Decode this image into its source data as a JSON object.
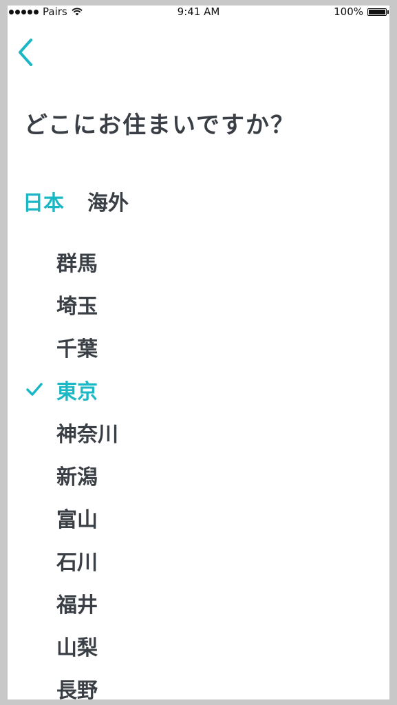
{
  "status_bar": {
    "carrier": "Pairs",
    "time": "9:41 AM",
    "battery": "100%",
    "icons": [
      "signal-icon",
      "wifi-icon",
      "battery-icon"
    ]
  },
  "header": {
    "back_icon": "chevron-left-icon",
    "title": "どこにお住まいですか？"
  },
  "tabs": [
    {
      "label": "日本",
      "active": true
    },
    {
      "label": "海外",
      "active": false
    }
  ],
  "prefectures": [
    {
      "label": "群馬",
      "selected": false
    },
    {
      "label": "埼玉",
      "selected": false
    },
    {
      "label": "千葉",
      "selected": false
    },
    {
      "label": "東京",
      "selected": true
    },
    {
      "label": "神奈川",
      "selected": false
    },
    {
      "label": "新潟",
      "selected": false
    },
    {
      "label": "富山",
      "selected": false
    },
    {
      "label": "石川",
      "selected": false
    },
    {
      "label": "福井",
      "selected": false
    },
    {
      "label": "山梨",
      "selected": false
    },
    {
      "label": "長野",
      "selected": false
    }
  ],
  "colors": {
    "accent": "#1ab7c4",
    "text": "#3a3f45",
    "background": "#ffffff",
    "frame": "#c8c8c8"
  }
}
